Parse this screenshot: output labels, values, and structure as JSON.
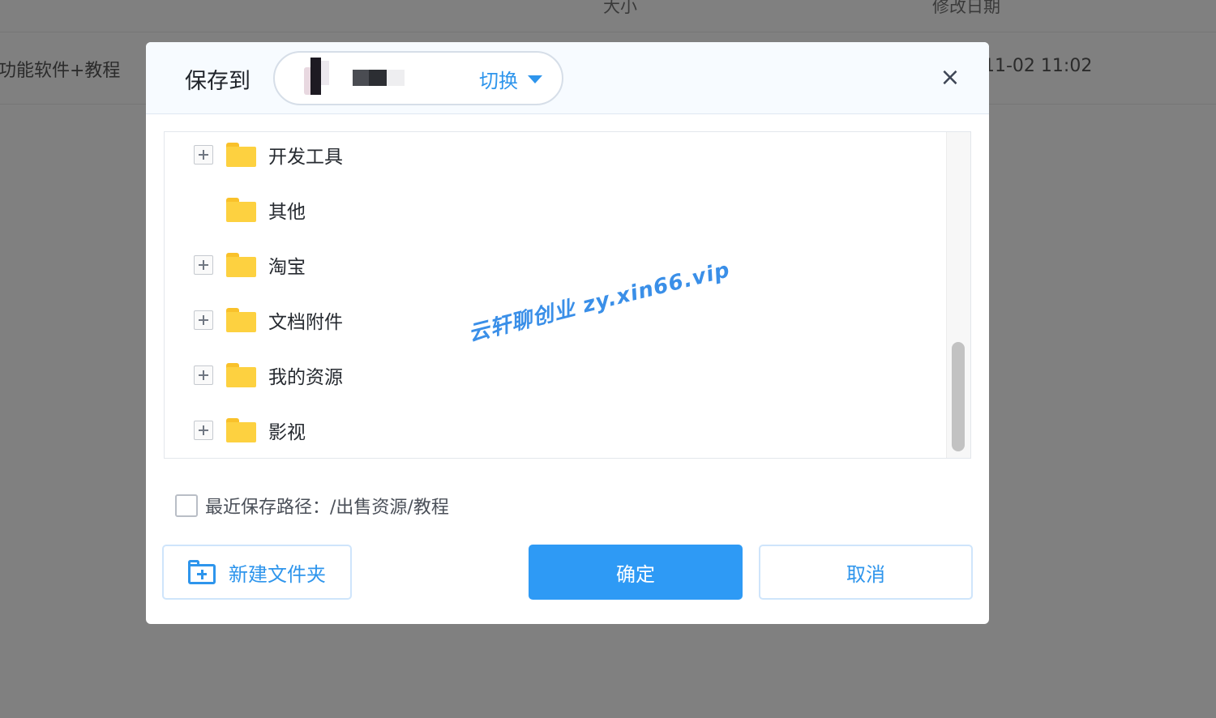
{
  "background": {
    "columns": [
      "大小",
      "修改日期"
    ],
    "row": {
      "name": "功能软件+教程",
      "date": "11-02 11:02"
    }
  },
  "dialog": {
    "title": "保存到",
    "account": {
      "switch_label": "切换"
    },
    "close_label": "×",
    "folders": [
      {
        "name": "开发工具",
        "expandable": true
      },
      {
        "name": "其他",
        "expandable": false
      },
      {
        "name": "淘宝",
        "expandable": true
      },
      {
        "name": "文档附件",
        "expandable": true
      },
      {
        "name": "我的资源",
        "expandable": true
      },
      {
        "name": "影视",
        "expandable": true
      }
    ],
    "watermark": "云轩聊创业 zy.xin66.vip",
    "recent_path_label": "最近保存路径：/出售资源/教程",
    "buttons": {
      "new_folder": "新建文件夹",
      "confirm": "确定",
      "cancel": "取消"
    },
    "colors": {
      "accent": "#2e9af5",
      "folder": "#fdd140"
    }
  }
}
